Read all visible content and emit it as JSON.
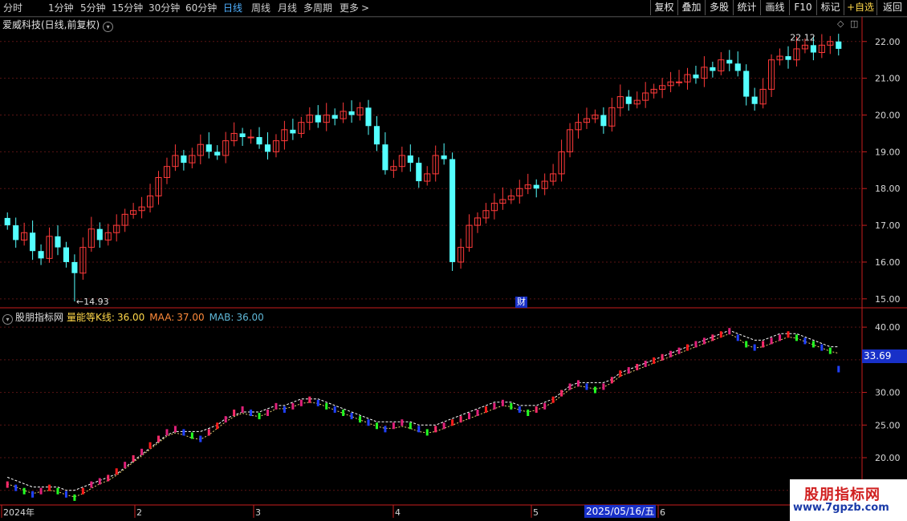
{
  "toolbar": {
    "periods": [
      "分时",
      "1分钟",
      "5分钟",
      "15分钟",
      "30分钟",
      "60分钟",
      "日线",
      "周线",
      "月线",
      "多周期",
      "更多"
    ],
    "active_period": "日线",
    "more_arrow": ">",
    "right_buttons": [
      "复权",
      "叠加",
      "多股",
      "统计",
      "画线",
      "F10",
      "标记",
      "+自选",
      "返回"
    ]
  },
  "main_chart": {
    "title": "爱威科技(日线,前复权)",
    "title_icon": "chevron-down-icon",
    "y_ticks": [
      "22.00",
      "21.00",
      "20.00",
      "19.00",
      "18.00",
      "17.00",
      "16.00",
      "15.00"
    ],
    "high_label": "22.12",
    "low_label": "14.93",
    "low_arrow": "←",
    "marker": "财",
    "up_color": "#ff3a3a",
    "down_color": "#54ffff"
  },
  "indicator": {
    "name": "股朋指标网",
    "k_label": "量能等K线:",
    "k_value": "36.00",
    "maa_label": "MAA:",
    "maa_value": "37.00",
    "mab_label": "MAB:",
    "mab_value": "36.00",
    "y_ticks": [
      "40.00",
      "35.00",
      "30.00",
      "25.00",
      "20.00",
      "15.00"
    ],
    "last_value": "33.69"
  },
  "time_axis": {
    "labels": [
      "2024年",
      "2",
      "3",
      "4",
      "5",
      "6"
    ],
    "cursor_date": "2025/05/16/五"
  },
  "watermark": {
    "line1": "股朋指标网",
    "line2": "www.7gpzb.com"
  },
  "chart_data": [
    {
      "type": "candlestick",
      "title": "爱威科技(日线,前复权)",
      "ylim": [
        14.8,
        22.3
      ],
      "annotations": {
        "high": 22.12,
        "low": 14.93
      },
      "closes": [
        17.0,
        16.6,
        16.8,
        16.3,
        16.1,
        16.7,
        16.4,
        16.0,
        15.7,
        16.4,
        16.9,
        16.6,
        16.8,
        17.0,
        17.3,
        17.4,
        17.5,
        17.8,
        18.3,
        18.6,
        18.9,
        18.7,
        18.9,
        19.2,
        19.0,
        18.9,
        19.3,
        19.5,
        19.4,
        19.4,
        19.2,
        19.0,
        19.3,
        19.6,
        19.5,
        19.8,
        20.0,
        19.8,
        20.0,
        19.9,
        20.1,
        20.0,
        20.2,
        19.7,
        19.2,
        18.5,
        18.6,
        18.9,
        18.7,
        18.2,
        18.4,
        18.9,
        18.8,
        16.0,
        16.4,
        17.0,
        17.2,
        17.4,
        17.6,
        17.7,
        17.8,
        18.0,
        18.1,
        18.0,
        18.2,
        18.4,
        19.0,
        19.6,
        19.8,
        19.9,
        20.0,
        19.7,
        20.2,
        20.5,
        20.3,
        20.4,
        20.6,
        20.7,
        20.8,
        20.9,
        20.9,
        21.1,
        21.0,
        21.3,
        21.2,
        21.5,
        21.4,
        21.2,
        20.5,
        20.3,
        20.7,
        21.5,
        21.6,
        21.5,
        21.8,
        21.9,
        21.7,
        21.9,
        22.0,
        21.8
      ],
      "xlabels": [
        "2024年",
        "2",
        "3",
        "4",
        "5",
        "6"
      ]
    },
    {
      "type": "line",
      "title": "股朋指标网",
      "ylim": [
        13,
        41
      ],
      "series": [
        {
          "name": "量能等K线",
          "values": [
            16.0,
            15.5,
            15.0,
            14.5,
            15.0,
            15.5,
            15.0,
            14.5,
            14.0,
            15.0,
            16.0,
            16.5,
            17.0,
            18.0,
            19.0,
            20.0,
            21.0,
            22.0,
            23.0,
            24.0,
            24.5,
            24.0,
            23.5,
            23.0,
            24.0,
            25.0,
            26.0,
            27.0,
            27.5,
            27.0,
            26.5,
            27.0,
            28.0,
            27.5,
            28.0,
            28.5,
            29.0,
            28.5,
            28.0,
            27.5,
            27.0,
            26.5,
            26.0,
            25.5,
            25.0,
            24.5,
            25.0,
            25.5,
            25.0,
            24.5,
            24.0,
            24.5,
            25.0,
            25.5,
            26.0,
            26.5,
            27.0,
            27.5,
            28.0,
            28.5,
            28.0,
            27.5,
            27.0,
            27.5,
            28.0,
            29.0,
            30.0,
            31.0,
            31.5,
            31.0,
            30.5,
            31.0,
            32.0,
            33.0,
            33.5,
            34.0,
            34.5,
            35.0,
            35.5,
            36.0,
            36.5,
            37.0,
            37.5,
            38.0,
            38.5,
            39.0,
            39.5,
            38.5,
            37.5,
            37.0,
            37.5,
            38.0,
            38.5,
            39.0,
            38.5,
            38.0,
            37.5,
            37.0,
            36.5,
            33.69
          ]
        },
        {
          "name": "MAA",
          "values": [
            17.0,
            16.5,
            16.0,
            15.5,
            15.5,
            15.5,
            15.5,
            15.0,
            15.0,
            15.5,
            16.0,
            16.5,
            17.0,
            17.5,
            18.5,
            19.5,
            20.5,
            21.5,
            22.5,
            23.5,
            24.0,
            24.0,
            24.0,
            24.0,
            24.5,
            25.0,
            26.0,
            26.5,
            27.0,
            27.0,
            27.0,
            27.5,
            28.0,
            28.0,
            28.5,
            29.0,
            29.0,
            29.0,
            28.5,
            28.0,
            27.5,
            27.0,
            26.5,
            26.0,
            25.5,
            25.5,
            25.5,
            25.5,
            25.5,
            25.0,
            25.0,
            25.0,
            25.5,
            26.0,
            26.5,
            27.0,
            27.5,
            28.0,
            28.5,
            28.5,
            28.5,
            28.0,
            28.0,
            28.0,
            28.5,
            29.0,
            30.0,
            31.0,
            31.5,
            31.5,
            31.5,
            31.5,
            32.0,
            33.0,
            33.5,
            34.0,
            34.5,
            35.0,
            35.5,
            36.0,
            36.5,
            37.0,
            37.5,
            38.0,
            38.5,
            39.0,
            39.5,
            39.0,
            38.5,
            38.0,
            38.0,
            38.5,
            39.0,
            39.0,
            39.0,
            38.5,
            38.0,
            37.5,
            37.0,
            37.0
          ]
        },
        {
          "name": "MAB",
          "values": [
            16.0,
            15.5,
            15.0,
            14.5,
            14.8,
            15.0,
            14.8,
            14.3,
            14.0,
            14.5,
            15.3,
            16.0,
            16.5,
            17.3,
            18.3,
            19.3,
            20.3,
            21.3,
            22.3,
            23.3,
            23.8,
            23.5,
            23.0,
            22.8,
            23.5,
            24.5,
            25.5,
            26.3,
            26.8,
            26.5,
            26.3,
            26.8,
            27.5,
            27.5,
            27.8,
            28.3,
            28.5,
            28.3,
            27.8,
            27.3,
            26.8,
            26.3,
            25.8,
            25.3,
            24.8,
            24.5,
            24.5,
            24.8,
            24.5,
            24.0,
            23.8,
            24.0,
            24.5,
            25.0,
            25.5,
            26.0,
            26.5,
            27.0,
            27.5,
            28.0,
            27.8,
            27.3,
            27.0,
            27.3,
            27.8,
            28.5,
            29.5,
            30.5,
            31.0,
            30.8,
            30.5,
            30.8,
            31.5,
            32.5,
            33.0,
            33.5,
            34.0,
            34.5,
            35.0,
            35.5,
            36.0,
            36.5,
            37.0,
            37.5,
            38.0,
            38.5,
            39.0,
            38.3,
            37.3,
            36.8,
            37.0,
            37.5,
            38.0,
            38.5,
            38.3,
            37.8,
            37.3,
            36.8,
            36.3,
            36.0
          ]
        }
      ],
      "xlabels": [
        "2024年",
        "2",
        "3",
        "4",
        "5",
        "6"
      ]
    }
  ]
}
